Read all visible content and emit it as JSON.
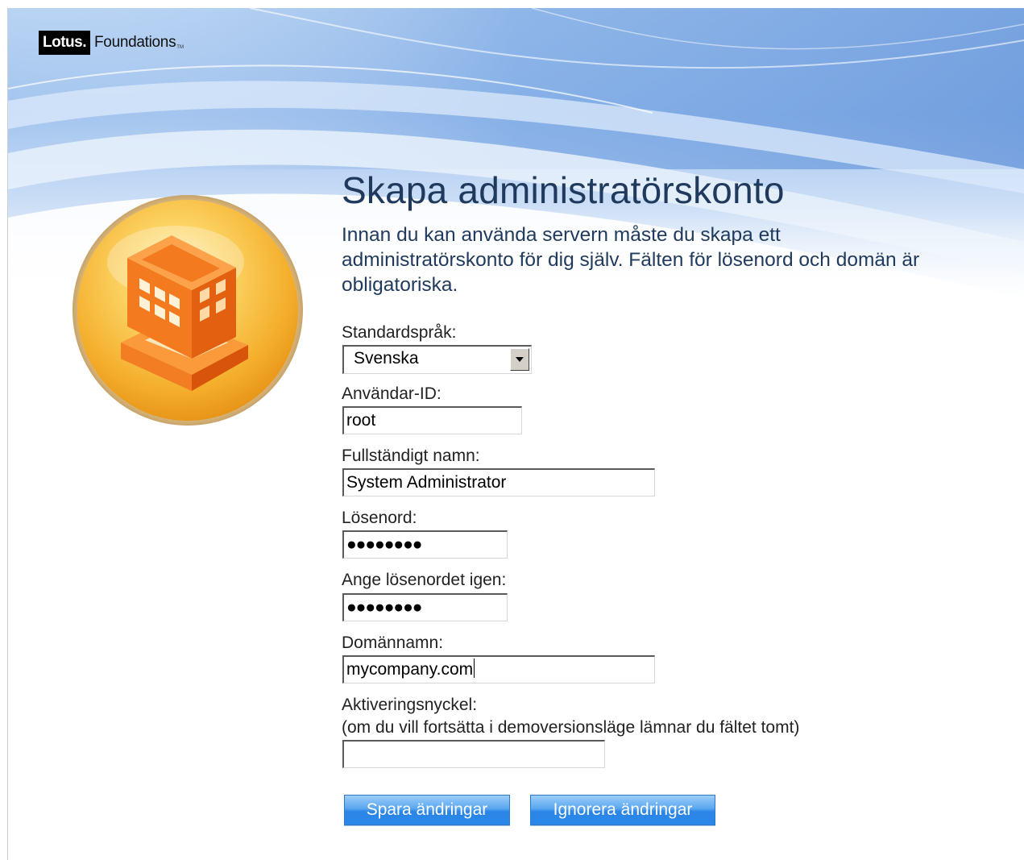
{
  "header": {
    "logo_brand": "Lotus.",
    "logo_product": "Foundations",
    "logo_tm": "TM"
  },
  "main": {
    "title": "Skapa administratörskonto",
    "intro_line1": "Innan du kan använda servern måste du skapa ett",
    "intro_line2": "administratörskonto för dig själv. Fälten för lösenord och domän är",
    "intro_line3": "obligatoriska."
  },
  "form": {
    "language": {
      "label": "Standardspråk:",
      "selected": "Svenska"
    },
    "user_id": {
      "label": "Användar-ID:",
      "value": "root"
    },
    "full_name": {
      "label": "Fullständigt namn:",
      "value": "System Administrator"
    },
    "password": {
      "label": "Lösenord:",
      "masked": "●●●●●●●●"
    },
    "password_confirm": {
      "label": "Ange lösenordet igen:",
      "masked": "●●●●●●●●"
    },
    "domain": {
      "label": "Domännamn:",
      "value": "mycompany.com"
    },
    "activation_key": {
      "label": "Aktiveringsnyckel:",
      "hint": "(om du vill fortsätta i demoversionsläge lämnar du fältet tomt)",
      "value": ""
    }
  },
  "buttons": {
    "save": "Spara ändringar",
    "ignore": "Ignorera ändringar"
  },
  "colors": {
    "title_text": "#1f3a5c",
    "button_blue": "#2a86e8",
    "emblem_orange": "#f47a20",
    "emblem_gold": "#f5a623"
  },
  "icons": {
    "emblem": "building-icon",
    "select_arrow": "chevron-down-icon"
  }
}
